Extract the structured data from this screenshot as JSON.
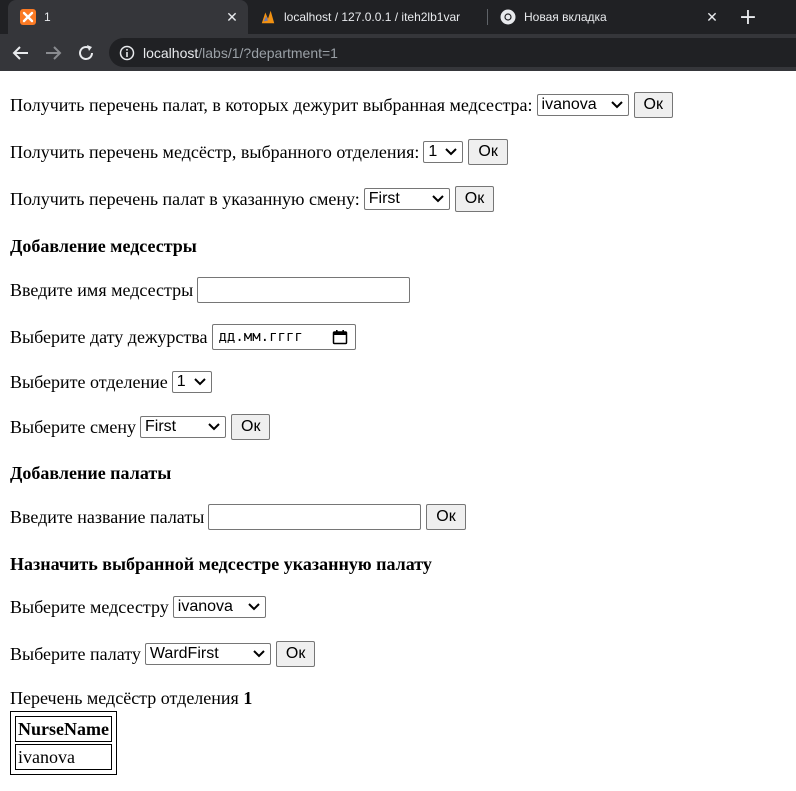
{
  "browser": {
    "tabs": [
      {
        "title": "1",
        "icon": "xampp-icon",
        "active": true
      },
      {
        "title": "localhost / 127.0.0.1 / iteh2lb1var",
        "icon": "phpmyadmin-icon",
        "active": false
      },
      {
        "title": "Новая вкладка",
        "icon": "chrome-icon",
        "active": false
      }
    ],
    "url_host": "localhost",
    "url_path": "/labs/1/?department=1"
  },
  "forms": {
    "wards_by_nurse": {
      "label": "Получить перечень палат, в которых дежурит выбранная медсестра:",
      "select": "ivanova",
      "button": "Ок"
    },
    "nurses_by_department": {
      "label": "Получить перечень медсёстр, выбранного отделения:",
      "select": "1",
      "button": "Ок"
    },
    "wards_by_shift": {
      "label": "Получить перечень палат в указанную смену:",
      "select": "First",
      "button": "Ок"
    }
  },
  "add_nurse": {
    "heading": "Добавление медсестры",
    "name_label": "Введите имя медсестры",
    "name_value": "",
    "date_label": "Выберите дату дежурства",
    "date_placeholder": "дд.мм.гггг",
    "department_label": "Выберите отделение",
    "department_value": "1",
    "shift_label": "Выберите смену",
    "shift_value": "First",
    "button": "Ок"
  },
  "add_ward": {
    "heading": "Добавление палаты",
    "name_label": "Введите название палаты",
    "name_value": "",
    "button": "Ок"
  },
  "assign": {
    "heading": "Назначить выбранной медсестре указанную палату",
    "nurse_label": "Выберите медсестру",
    "nurse_value": "ivanova",
    "ward_label": "Выберите палату",
    "ward_value": "WardFirst",
    "button": "Ок"
  },
  "result": {
    "caption": "Перечень медсёстр отделения",
    "department": "1",
    "columns": [
      "NurseName"
    ],
    "rows": [
      [
        "ivanova"
      ]
    ]
  },
  "colors": {
    "chrome_dark": "#202124",
    "chrome_tab": "#35363a",
    "xampp": "#fb7a24"
  }
}
